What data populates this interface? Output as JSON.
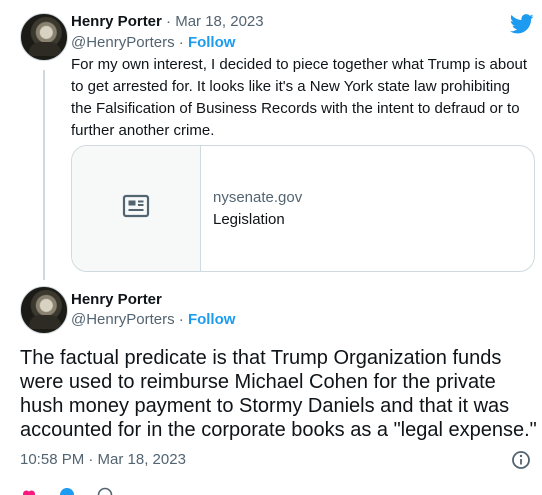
{
  "colors": {
    "accent": "#1d9bf0",
    "muted": "#536471",
    "text": "#0f1419",
    "border": "#cfd9de"
  },
  "tweet1": {
    "name": "Henry Porter",
    "separator": "·",
    "date": "Mar 18, 2023",
    "handle": "@HenryPorters",
    "follow_separator": "·",
    "follow_label": "Follow",
    "text": "For my own interest, I decided to piece together what Trump is about to get arrested for. It looks like it's a New York state law prohibiting the Falsification of Business Records with the intent to defraud or to further another crime.",
    "card": {
      "icon": "article-icon",
      "domain": "nysenate.gov",
      "title": "Legislation"
    }
  },
  "tweet2": {
    "name": "Henry Porter",
    "handle": "@HenryPorters",
    "follow_separator": "·",
    "follow_label": "Follow",
    "text": "The factual predicate is that Trump Organization funds were used to reimburse Michael Cohen for the private hush money payment to Stormy Daniels and that it was accounted for in the corporate books as a \"legal expense.\"",
    "timestamp": "10:58 PM · Mar 18, 2023"
  },
  "icons": {
    "logo": "twitter-bird-icon",
    "info": "info-icon"
  }
}
